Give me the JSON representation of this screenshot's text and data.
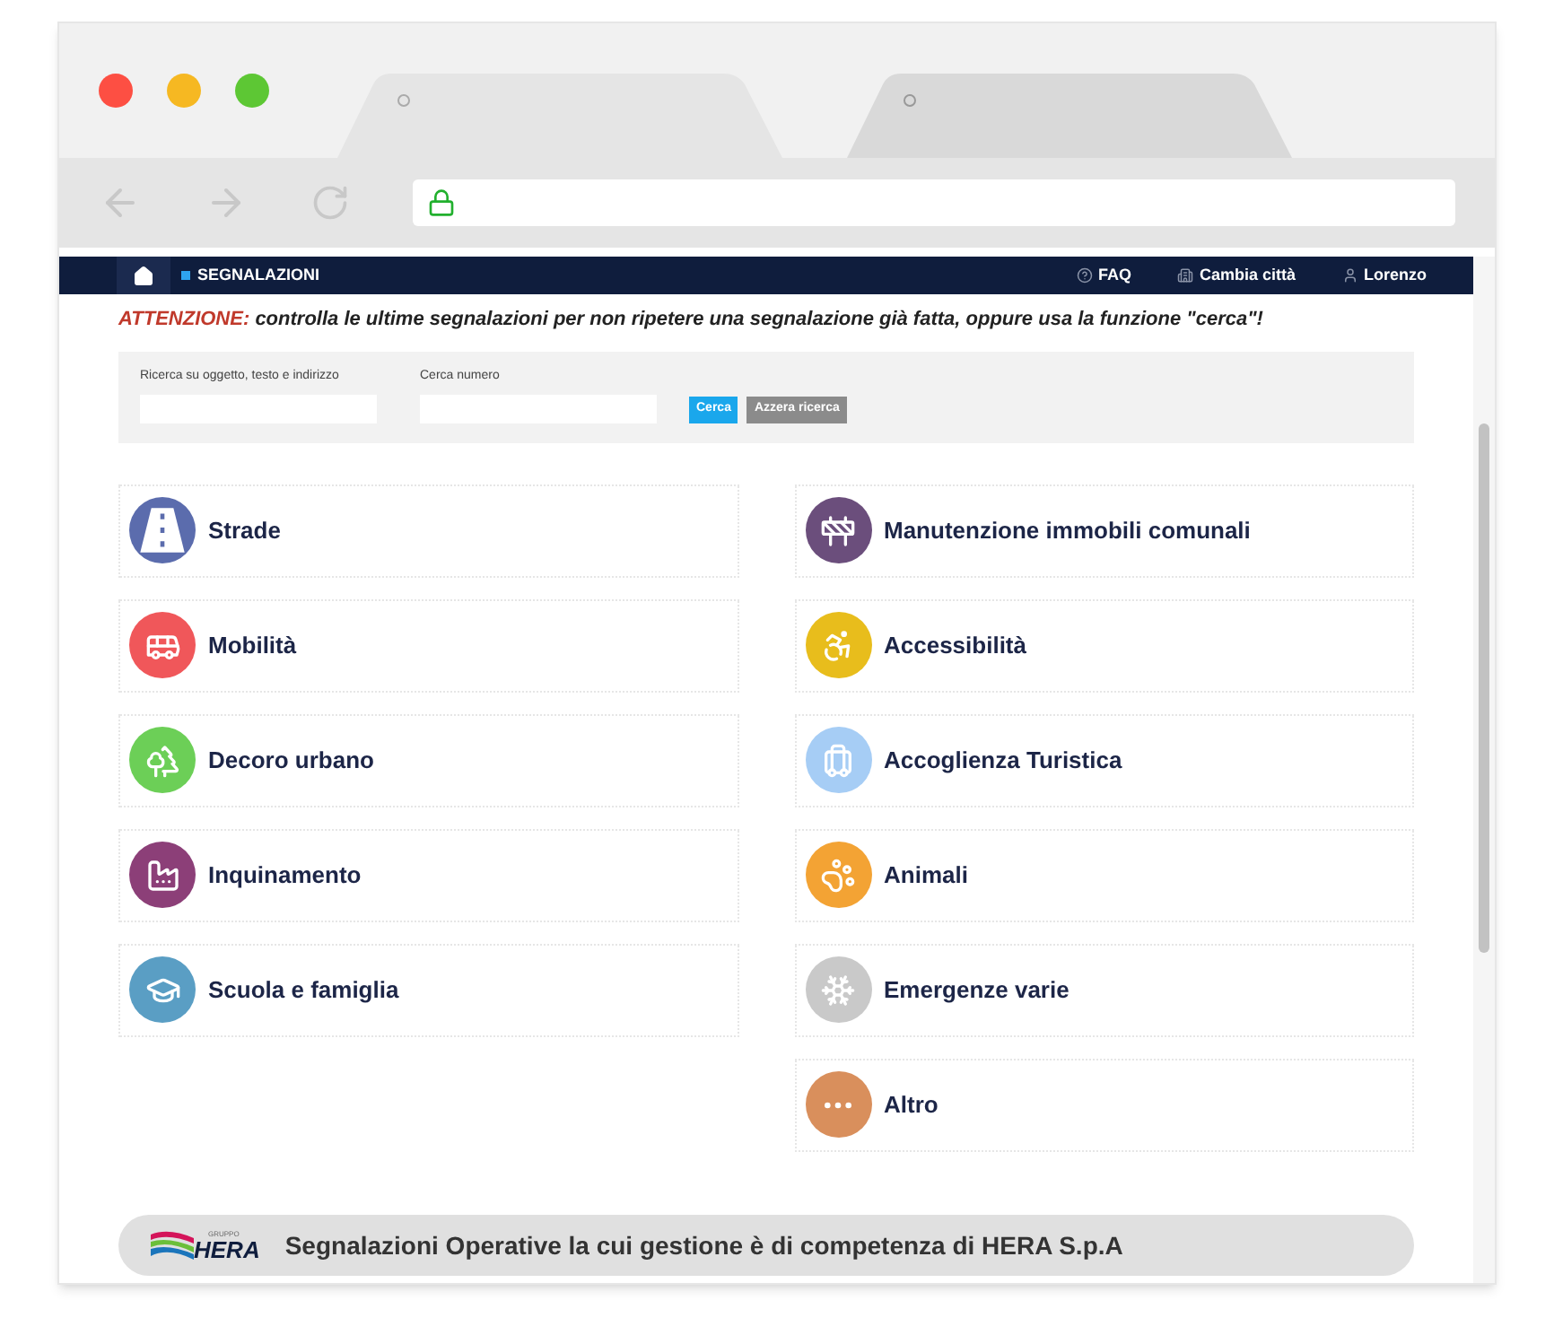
{
  "navbar": {
    "section": "SEGNALAZIONI",
    "links": [
      "FAQ",
      "Cambia città",
      "Lorenzo"
    ]
  },
  "notice": {
    "label": "ATTENZIONE:",
    "text": "controlla le ultime segnalazioni per non ripetere una segnalazione già fatta, oppure usa la funzione \"cerca\"!"
  },
  "search": {
    "fields": [
      {
        "label": "Ricerca su oggetto, testo e indirizzo"
      },
      {
        "label": "Cerca numero"
      }
    ],
    "buttons": [
      {
        "label": "Cerca",
        "kind": "primary"
      },
      {
        "label": "Azzera ricerca",
        "kind": "secondary"
      }
    ]
  },
  "categories": [
    [
      {
        "label": "Strade",
        "color": "#5b6cad"
      },
      {
        "label": "Mobilità",
        "color": "#f0575a"
      },
      {
        "label": "Decoro urbano",
        "color": "#6ccf57"
      },
      {
        "label": "Inquinamento",
        "color": "#8c3f78"
      },
      {
        "label": "Scuola e famiglia",
        "color": "#5a9ec4"
      }
    ],
    [
      {
        "label": "Manutenzione immobili comunali",
        "color": "#6b4e7c"
      },
      {
        "label": "Accessibilità",
        "color": "#e8bd1c"
      },
      {
        "label": "Accoglienza Turistica",
        "color": "#a6cdf5"
      },
      {
        "label": "Animali",
        "color": "#f3a334"
      },
      {
        "label": "Emergenze varie",
        "color": "#c9c9c9"
      },
      {
        "label": "Altro",
        "color": "#d98f5c"
      }
    ]
  ],
  "footer": {
    "logo_small": "GRUPPO",
    "logo": "HERA",
    "text": "Segnalazioni Operative la cui gestione è di competenza di HERA S.p.A"
  }
}
